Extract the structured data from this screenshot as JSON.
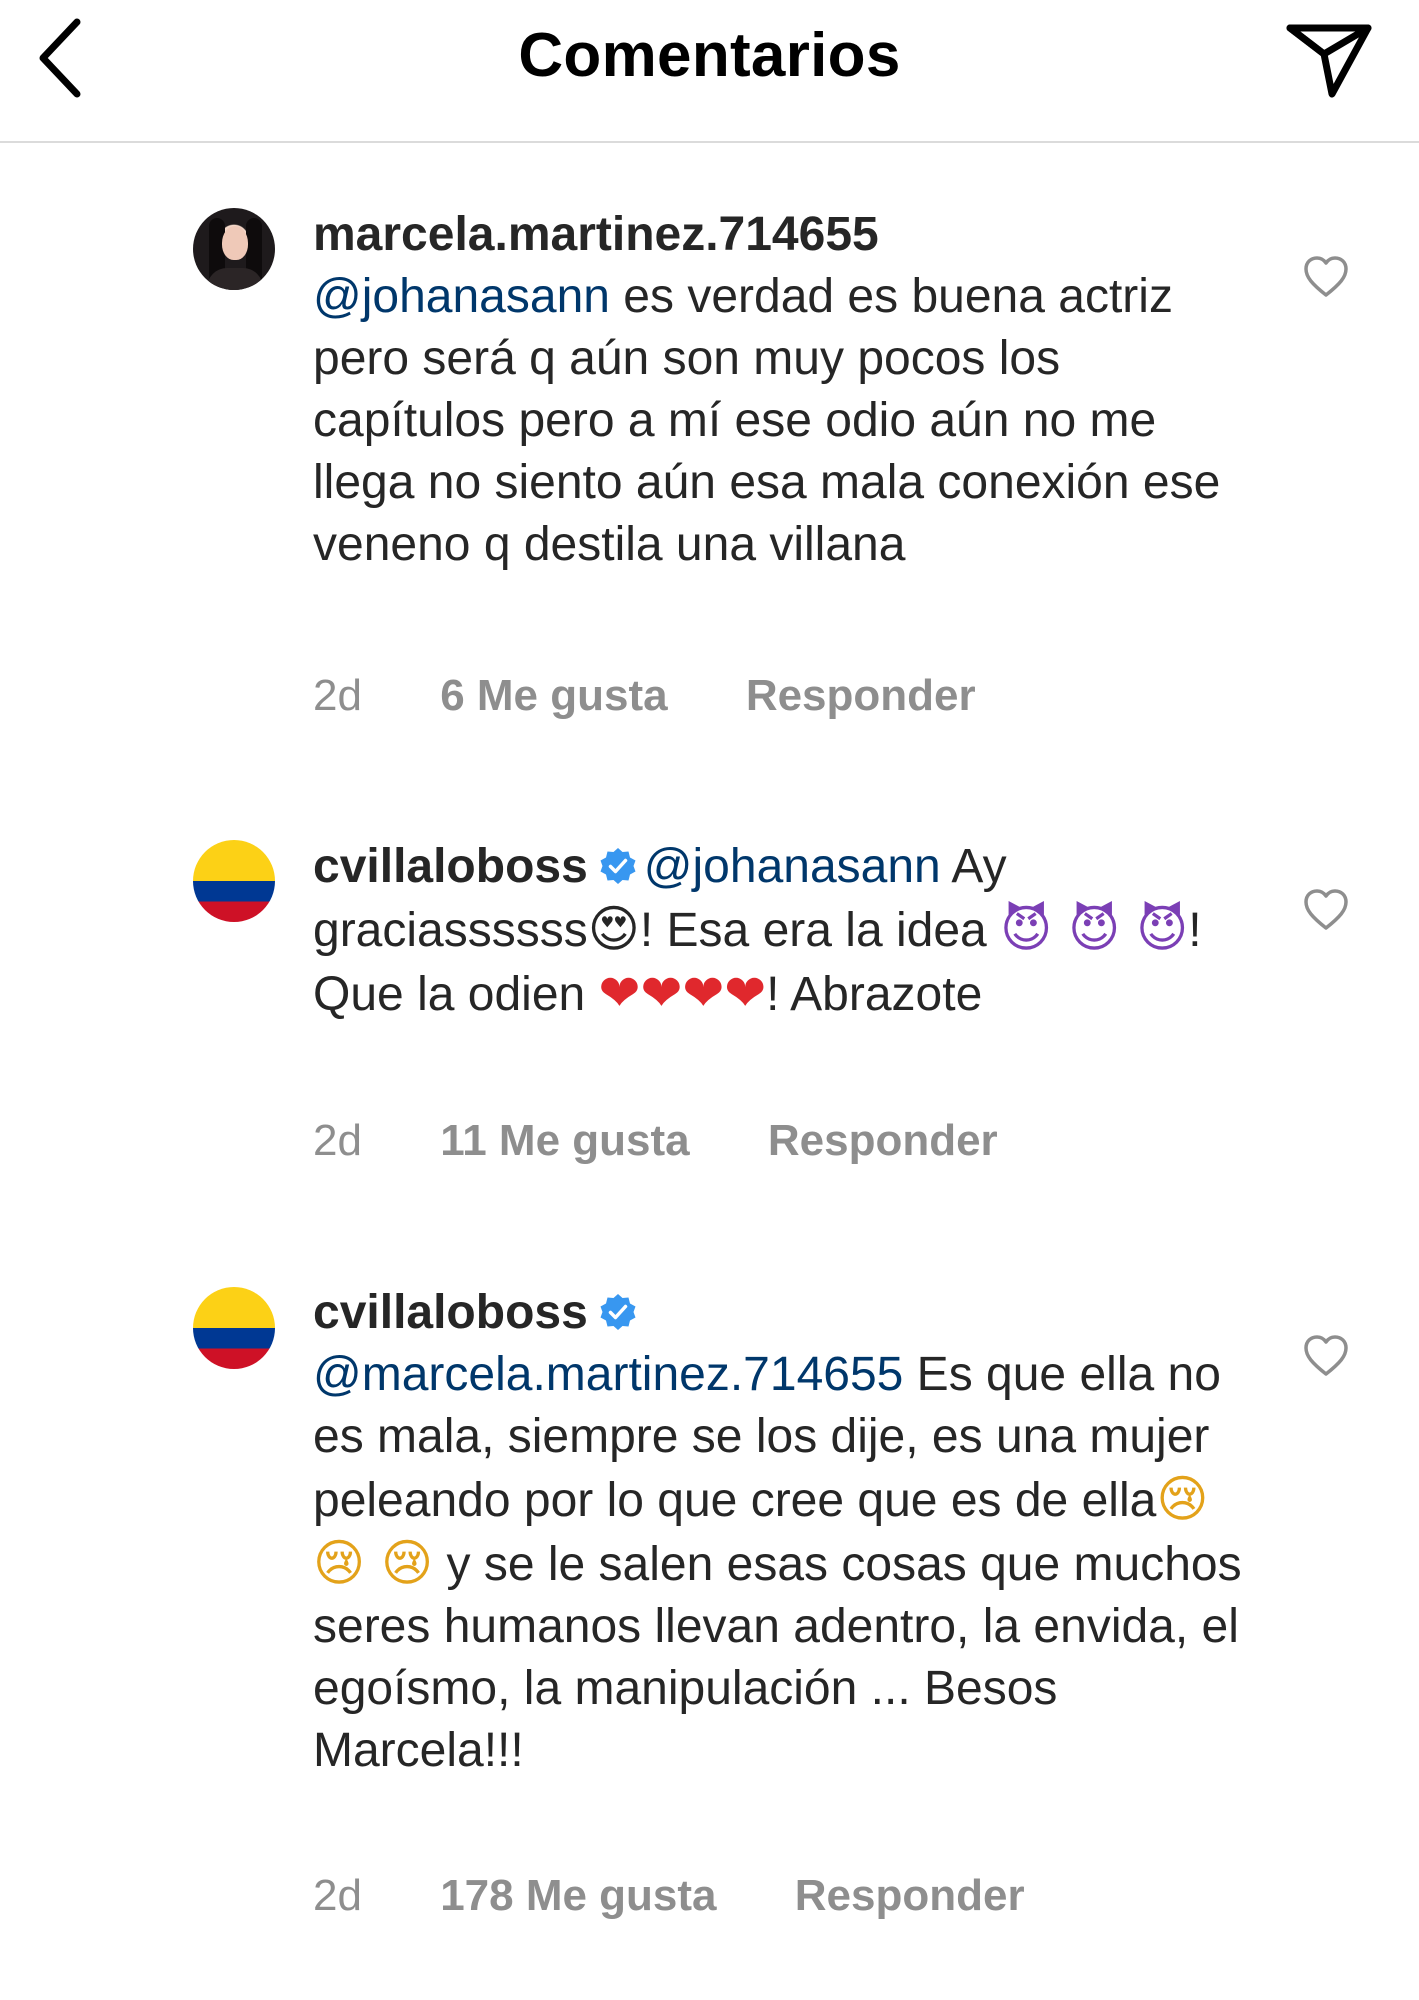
{
  "header": {
    "title": "Comentarios",
    "back_icon": "chevron-left-icon",
    "send_icon": "paper-plane-icon"
  },
  "colors": {
    "text": "#262626",
    "mention": "#00376b",
    "meta": "#8e8e8e",
    "verified": "#3897f0",
    "divider": "#dbdbdb"
  },
  "comments": [
    {
      "username": "marcela.martinez.714655",
      "verified": false,
      "avatar": "profile-photo",
      "mention": "@johanasann",
      "text": " es verdad es buena actriz pero será q aún son muy pocos los capítulos pero a mí ese odio aún no me llega no siento aún esa mala conexión ese veneno q destila una villana",
      "time": "2d",
      "likes": "6 Me gusta",
      "reply": "Responder"
    },
    {
      "username": "cvillaloboss",
      "verified": true,
      "avatar": "colombia-flag",
      "mention": "@johanasann",
      "text_1": " Ay graciassssss",
      "emoji_1": "😍",
      "text_2": "! Esa era la idea ",
      "emoji_2": "😈 😈 😈",
      "text_3": "! Que la odien ",
      "emoji_3": "❤❤❤❤",
      "text_4": "! Abrazote",
      "time": "2d",
      "likes": "11 Me gusta",
      "reply": "Responder"
    },
    {
      "username": "cvillaloboss",
      "verified": true,
      "avatar": "colombia-flag",
      "mention": "@marcela.martinez.714655",
      "text_1": " Es que ella no es mala, siempre se los dije, es una mujer peleando por lo que cree que es de ella",
      "emoji_1": "😢 😢 😢",
      "text_2": "  y se le salen esas cosas que muchos seres humanos llevan adentro, la envida, el egoísmo, la manipulación ... Besos Marcela!!!",
      "time": "2d",
      "likes": "178 Me gusta",
      "reply": "Responder"
    }
  ]
}
